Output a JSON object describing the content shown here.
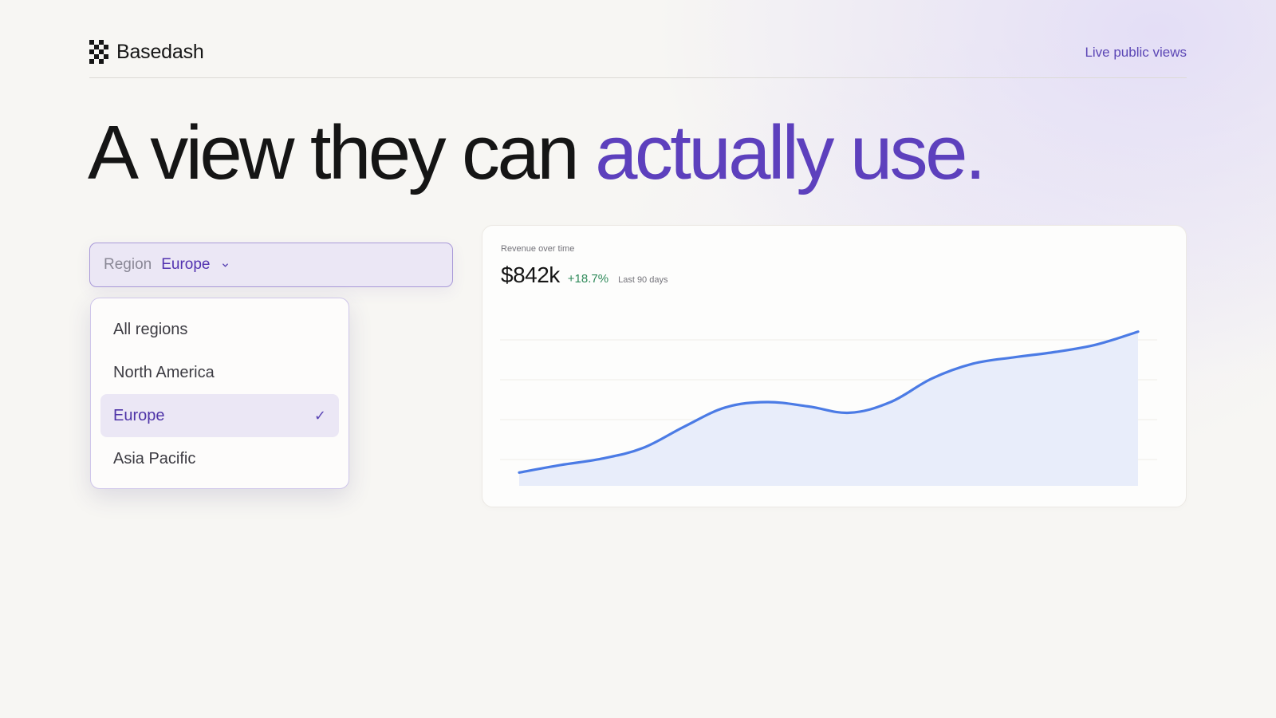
{
  "header": {
    "brand_name": "Basedash",
    "nav_link": "Live public views"
  },
  "headline": {
    "text_main": "A view they can ",
    "text_accent": "actually use."
  },
  "filter": {
    "label": "Region",
    "value": "Europe",
    "options": [
      {
        "label": "All regions",
        "selected": false
      },
      {
        "label": "North America",
        "selected": false
      },
      {
        "label": "Europe",
        "selected": true
      },
      {
        "label": "Asia Pacific",
        "selected": false
      }
    ],
    "check_glyph": "✓"
  },
  "card": {
    "title": "Revenue over time",
    "value": "$842k",
    "change": "+18.7%",
    "period": "Last 90 days"
  },
  "colors": {
    "accent": "#5d40bd",
    "line": "#4b7be5",
    "area": "#e8edfa",
    "positive": "#2f8a5a"
  },
  "icons": {
    "logo": "basedash-checker-logo-icon",
    "chevron": "chevron-down-icon",
    "check": "check-icon"
  },
  "chart_data": {
    "type": "area",
    "title": "Revenue over time",
    "x": [
      0,
      1,
      2,
      3,
      4,
      5,
      6,
      7,
      8,
      9,
      10,
      11,
      12,
      13,
      14,
      15
    ],
    "values": [
      0.02,
      0.09,
      0.15,
      0.25,
      0.45,
      0.63,
      0.68,
      0.64,
      0.58,
      0.68,
      0.9,
      1.04,
      1.1,
      1.15,
      1.22,
      1.34
    ],
    "ylim": [
      0,
      1.45
    ],
    "gridlines": 4,
    "grid": true
  }
}
